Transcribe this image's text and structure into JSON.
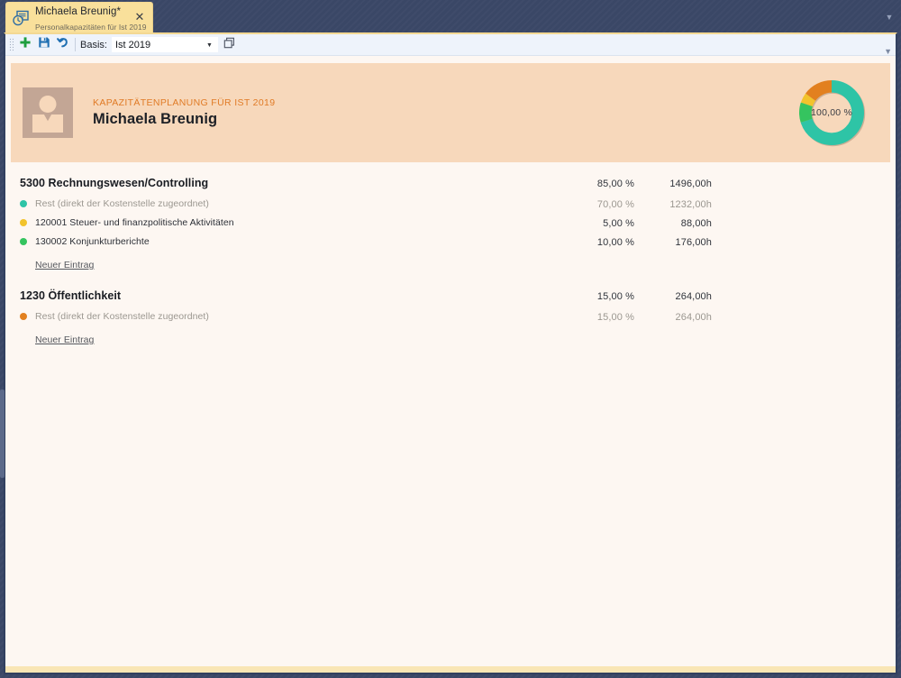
{
  "window": {
    "tab": {
      "icon": "window-clock-icon",
      "title": "Michaela Breunig*",
      "subtitle": "Personalkapazitäten für Ist 2019",
      "close_label": "✕"
    },
    "chrome_chevron": "▼"
  },
  "toolbar": {
    "add_label": "add-icon",
    "save_label": "save-icon",
    "undo_label": "undo-icon",
    "basis_label": "Basis:",
    "basis_value": "Ist 2019",
    "basis_placeholder": "Ist 2019",
    "basis_arrow": "▼",
    "copy_label": "copy-icon",
    "overflow_chevron": "▼"
  },
  "banner": {
    "eyebrow": "KAPAZITÄTENPLANUNG FÜR IST 2019",
    "name": "Michaela Breunig",
    "avatar_alt": "person-avatar",
    "background": "#f7d8bb",
    "accent": "#e07b26"
  },
  "chart_data": {
    "type": "pie",
    "title": "",
    "center_label": "100,00 %",
    "total_percent": 100.0,
    "legend": [],
    "categories": [
      "Rest (direkt der Kostenstelle zugeordnet) - 5300",
      "130002 Konjunkturberichte",
      "120001 Steuer- und finanzpolitische Aktivitäten",
      "Rest (direkt der Kostenstelle zugeordnet) - 1230"
    ],
    "values": [
      70.0,
      10.0,
      5.0,
      15.0
    ],
    "colors": [
      "#2ec4a6",
      "#35c45f",
      "#f2c32c",
      "#e2801f"
    ],
    "units": "%",
    "hole_ratio": 0.62
  },
  "groups": [
    {
      "id": "5300",
      "title": "5300 Rechnungswesen/Controlling",
      "percent": "85,00 %",
      "hours": "1496,00h",
      "items": [
        {
          "label": "Rest (direkt der Kostenstelle zugeordnet)",
          "percent": "70,00 %",
          "hours": "1232,00h",
          "color": "#2ec4a6",
          "muted": true
        },
        {
          "label": "120001 Steuer- und finanzpolitische Aktivitäten",
          "percent": "5,00 %",
          "hours": "88,00h",
          "color": "#f2c32c",
          "muted": false
        },
        {
          "label": "130002 Konjunkturberichte",
          "percent": "10,00 %",
          "hours": "176,00h",
          "color": "#35c45f",
          "muted": false
        }
      ],
      "new_entry_label": "Neuer Eintrag"
    },
    {
      "id": "1230",
      "title": "1230 Öffentlichkeit",
      "percent": "15,00 %",
      "hours": "264,00h",
      "items": [
        {
          "label": "Rest (direkt der Kostenstelle zugeordnet)",
          "percent": "15,00 %",
          "hours": "264,00h",
          "color": "#e2801f",
          "muted": true
        }
      ],
      "new_entry_label": "Neuer Eintrag"
    }
  ]
}
